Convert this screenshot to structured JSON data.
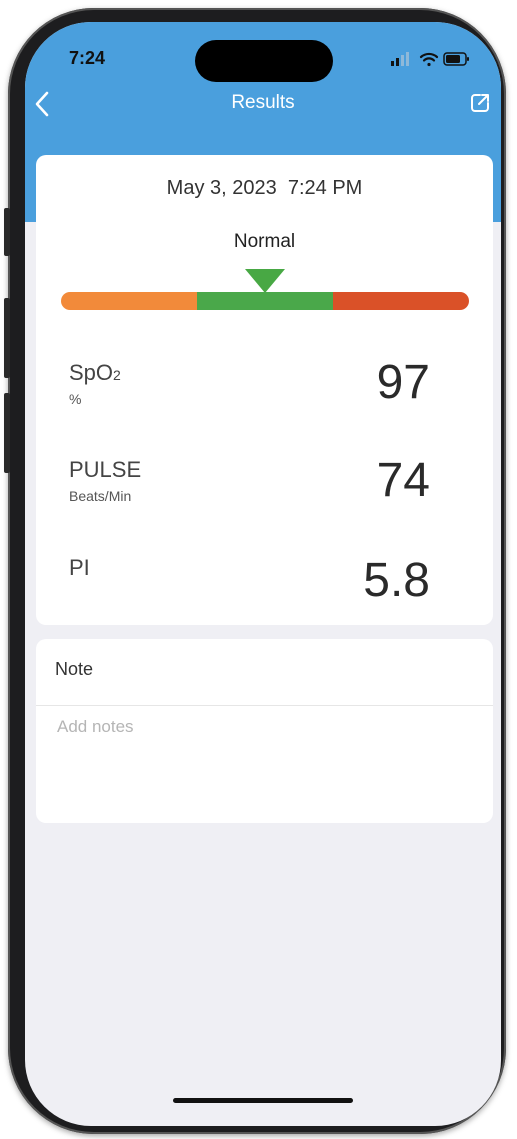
{
  "status_bar": {
    "time": "7:24"
  },
  "nav": {
    "title": "Results"
  },
  "measurement": {
    "date": "May 3, 2023",
    "time": "7:24 PM",
    "status": "Normal"
  },
  "range_bar": {
    "segment_colors": [
      "#f28a3a",
      "#4aa84a",
      "#da5128"
    ],
    "indicator_color": "#48a844"
  },
  "metrics": [
    {
      "label": "SpO",
      "subscript": "2",
      "unit": "%",
      "value": "97"
    },
    {
      "label": "PULSE",
      "unit": "Beats/Min",
      "value": "74"
    },
    {
      "label": "PI",
      "unit": "",
      "value": "5.8"
    }
  ],
  "note": {
    "title": "Note",
    "placeholder": "Add notes"
  },
  "colors": {
    "header": "#4a9fdd",
    "background": "#efeff4"
  }
}
